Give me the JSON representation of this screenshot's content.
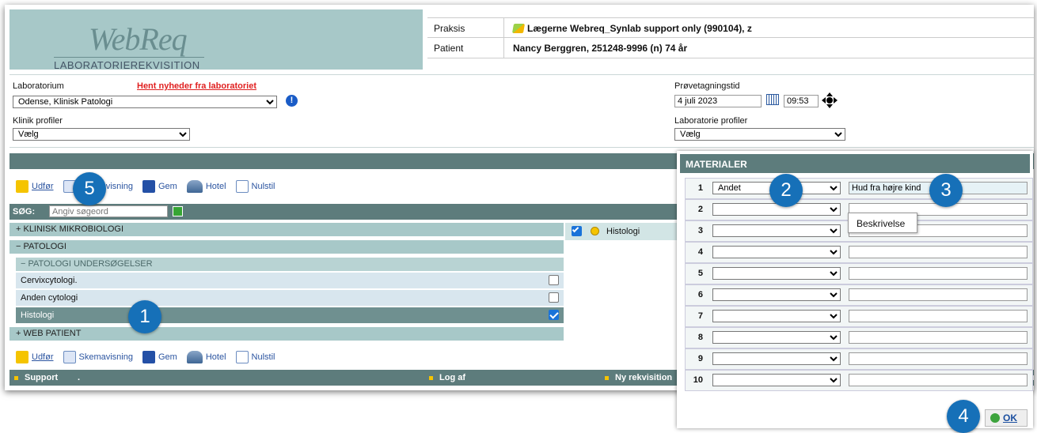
{
  "header": {
    "logo_title": "WebReq",
    "logo_subtitle": "LABORATORIEREKVISITION",
    "praksis_label": "Praksis",
    "praksis_value": "Lægerne Webreq_Synlab support only (990104), z",
    "patient_label": "Patient",
    "patient_value": "Nancy Berggren, 251248-9996 (n)  74 år"
  },
  "form": {
    "laboratorium_label": "Laboratorium",
    "news_link": "Hent nyheder fra laboratoriet",
    "laboratorium_value": "Odense, Klinisk Patologi",
    "klinik_profiler_label": "Klinik profiler",
    "klinik_profiler_value": "Vælg",
    "provetagningstid_label": "Prøvetagningstid",
    "date_value": "4 juli 2023",
    "time_value": "09:53",
    "lab_profiler_label": "Laboratorie profiler",
    "lab_profiler_value": "Vælg"
  },
  "toolbar": {
    "udfor": "Udfør",
    "skemavisning": "Skemavisning",
    "gem": "Gem",
    "hotel": "Hotel",
    "nulstil": "Nulstil"
  },
  "search": {
    "label": "SØG:",
    "placeholder": "Angiv søgeord"
  },
  "tree": {
    "klinisk": "+ KLINISK MIKROBIOLOGI",
    "patologi": "− PATOLOGI",
    "patologi_us": "− PATOLOGI UNDERSØGELSER",
    "items": [
      {
        "label": "Cervixcytologi.",
        "checked": false
      },
      {
        "label": "Anden cytologi",
        "checked": false
      },
      {
        "label": "Histologi",
        "checked": true
      }
    ],
    "web_patient": "+ WEB PATIENT"
  },
  "selected": {
    "label": "Histologi"
  },
  "footer": {
    "support": "Support",
    "dot": ".",
    "log_af": "Log af",
    "ny_rekvisition": "Ny rekvisition",
    "cut": "er"
  },
  "materialer": {
    "title": "MATERIALER",
    "rows": [
      {
        "n": "1",
        "select": "Andet",
        "desc": "Hud fra højre kind"
      },
      {
        "n": "2",
        "select": "",
        "desc": ""
      },
      {
        "n": "3",
        "select": "",
        "desc": ""
      },
      {
        "n": "4",
        "select": "",
        "desc": ""
      },
      {
        "n": "5",
        "select": "",
        "desc": ""
      },
      {
        "n": "6",
        "select": "",
        "desc": ""
      },
      {
        "n": "7",
        "select": "",
        "desc": ""
      },
      {
        "n": "8",
        "select": "",
        "desc": ""
      },
      {
        "n": "9",
        "select": "",
        "desc": ""
      },
      {
        "n": "10",
        "select": "",
        "desc": ""
      }
    ],
    "tooltip": "Beskrivelse",
    "ok": "OK"
  },
  "badges": [
    "1",
    "2",
    "3",
    "4",
    "5"
  ],
  "colors": {
    "teal_dark": "#5d7c7c",
    "teal_light": "#a7c8c8",
    "badge_blue": "#1670b8",
    "link_red": "#e02020"
  }
}
